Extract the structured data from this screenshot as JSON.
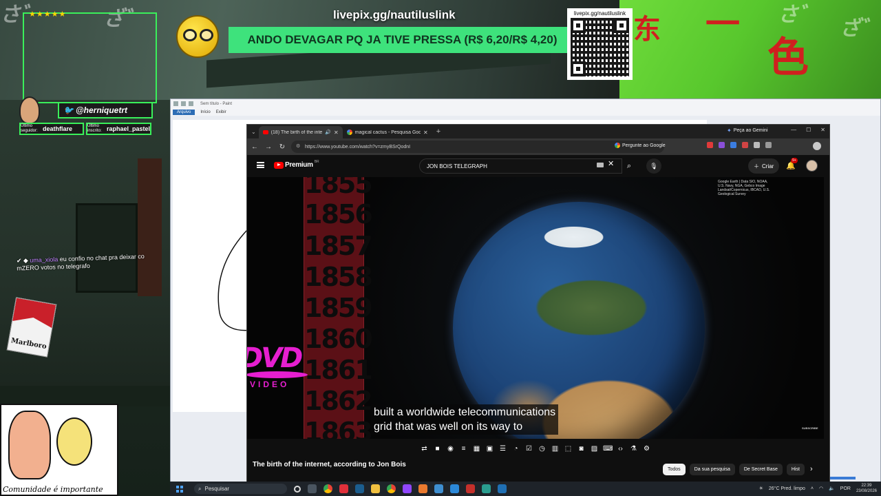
{
  "stream": {
    "livepix_url": "livepix.gg/nautiluslink",
    "banner_text": "ANDO DEVAGAR PQ JA TIVE PRESSA (R$ 6,20/R$ 4,20)",
    "qr_caption": "livepix.gg/nautiluslink",
    "twitter_handle": "@herniquetrt",
    "last_follower_label": "Último seguidor:",
    "last_follower": "deathflare",
    "last_sub_label": "Último inscrito:",
    "last_sub": "raphael_pastel",
    "stars": "★★★★★",
    "chat_user": "uma_xiola",
    "chat_message": "eu confio no chat pra deixar co mZERO votos no telegrafo",
    "cigarette_brand": "Marlboro",
    "comic_caption": "Comunidade é importante"
  },
  "paint": {
    "title": "Sem título - Paint",
    "tabs": [
      "Arquivo",
      "Início",
      "Exibir"
    ]
  },
  "browser": {
    "tabs": [
      {
        "title": "(18) The birth of the internet",
        "favicon": "youtube-icon"
      },
      {
        "title": "magical cactus - Pesquisa Google",
        "favicon": "google-icon"
      }
    ],
    "new_tab": "+",
    "gemini_label": "Peça ao Gemini",
    "url": "https://www.youtube.com/watch?v=zmyBSrQodnI",
    "ask_google": "Pergunte ao Google"
  },
  "youtube": {
    "brand": "Premium",
    "region": "BR",
    "search_value": "JON BOIS TELEGRAPH",
    "create_label": "Criar",
    "notif_count": "9+",
    "attribution": "Google Earth | Data SIO, NOAA, U.S. Navy, NGA, Gebco Image Landsat/Copernicus, IBCAO, U.S. Geological Survey",
    "years": [
      "1855",
      "1856",
      "1857",
      "1858",
      "1859",
      "1860",
      "1861",
      "1862",
      "1863"
    ],
    "subtitle_line1": "built a worldwide telecommunications",
    "subtitle_line2": "grid that was well on its way to",
    "subscribe_mark": "SUBSCRIBE",
    "video_title": "The birth of the internet, according to Jon Bois",
    "chips": [
      "Todos",
      "Da sua pesquisa",
      "De Secret Base",
      "Hist"
    ]
  },
  "dvd": {
    "logo": "DVD",
    "sub": "VIDEO"
  },
  "taskbar": {
    "search_placeholder": "Pesquisar",
    "weather": "26°C Pred. limpo",
    "lang": "POR",
    "time": "22:39",
    "date": "23/08/2026"
  },
  "colors": {
    "banner_green": "#3ee27c",
    "frame_green": "#3af05a",
    "dvd_magenta": "#e61fd0",
    "yt_red": "#ff0000"
  }
}
